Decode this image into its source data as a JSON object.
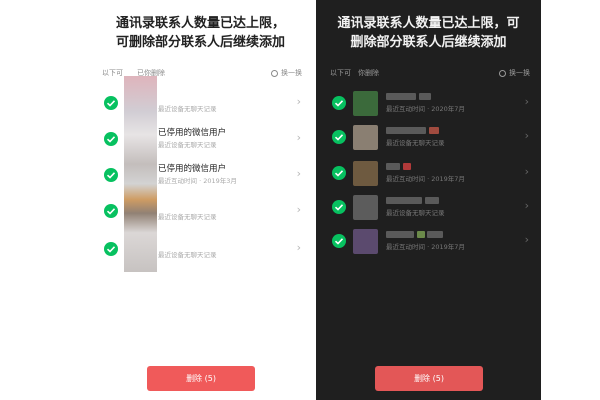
{
  "light": {
    "headline_line1": "通讯录联系人数量已达上限，",
    "headline_line2": "可删除部分联系人后继续添加",
    "list_hint": "以下可",
    "list_hint_suffix": "已你删除",
    "refresh_label": "换一换",
    "rows": [
      {
        "name": "",
        "subtitle": "最近设备无聊天记录"
      },
      {
        "name": "已停用的微信用户",
        "subtitle": "最近设备无聊天记录"
      },
      {
        "name": "已停用的微信用户",
        "subtitle": "最近互动时间 · 2019年3月"
      },
      {
        "name": "",
        "subtitle": "最近设备无聊天记录"
      },
      {
        "name": "",
        "subtitle": "最近设备无聊天记录"
      }
    ],
    "delete_label": "删除 (5)"
  },
  "dark": {
    "headline_line1": "通讯录联系人数量已达上限，可",
    "headline_line2": "删除部分联系人后继续添加",
    "list_hint": "以下可",
    "list_hint_suffix": "你删除",
    "refresh_label": "换一换",
    "rows": [
      {
        "name": "",
        "subtitle": "最近互动时间 · 2020年7月"
      },
      {
        "name": "",
        "subtitle": "最近设备无聊天记录"
      },
      {
        "name": "",
        "subtitle": "最近互动时间 · 2019年7月"
      },
      {
        "name": "",
        "subtitle": "最近设备无聊天记录"
      },
      {
        "name": "",
        "subtitle": "最近互动时间 · 2019年7月"
      }
    ],
    "delete_label": "删除 (5)"
  },
  "colors": {
    "check_green": "#07c160",
    "delete_red": "#f05a5a",
    "dark_bg": "#1f1f1f"
  },
  "icons": {
    "check": "check-circle-icon",
    "chevron": "chevron-right-icon",
    "refresh": "refresh-icon"
  }
}
